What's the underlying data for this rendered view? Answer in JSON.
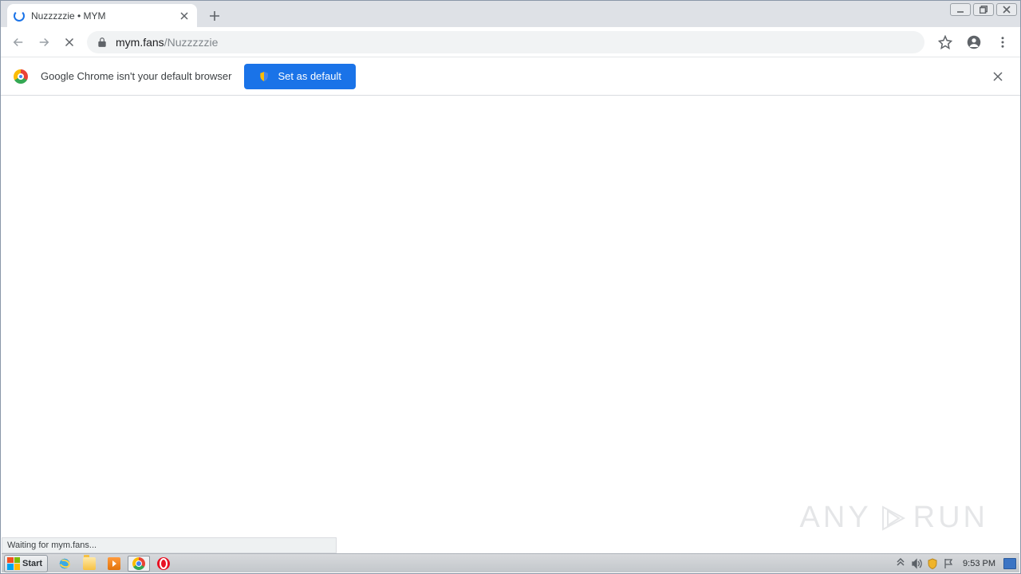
{
  "tab": {
    "title": "Nuzzzzzie • MYM"
  },
  "url": {
    "host": "mym.fans",
    "path": "/Nuzzzzzie"
  },
  "infobar": {
    "message": "Google Chrome isn't your default browser",
    "button": "Set as default"
  },
  "status": {
    "text": "Waiting for mym.fans..."
  },
  "watermark": {
    "left": "ANY",
    "right": "RUN"
  },
  "taskbar": {
    "start": "Start",
    "clock": "9:53 PM"
  }
}
